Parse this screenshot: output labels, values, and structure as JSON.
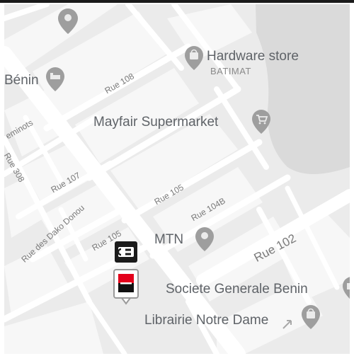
{
  "map": {
    "pois": {
      "hardware": "Hardware store",
      "hardware_sub": "BATIMAT",
      "benin": "Bénin",
      "mayfair": "Mayfair Supermarket",
      "mtn": "MTN",
      "societe": "Societe Generale Benin",
      "librairie": "Librairie Notre Dame"
    },
    "streets": {
      "rue108": "Rue 108",
      "seminots": "eminots",
      "rue308": "Rue 308",
      "rue107": "Rue 107",
      "dako": "Rue des Dako Donou",
      "rue105a": "Rue 105",
      "rue105b": "Rue 105",
      "rue104b": "Rue 104B",
      "rue102": "Rue 102"
    },
    "colors": {
      "land": "#ebebeb",
      "block": "#f5f5f5",
      "road": "#ffffff",
      "water": "#dadada",
      "pin": "#9e9e9e",
      "bank_red": "#e3001b",
      "cb_black": "#1b1b1b"
    }
  }
}
